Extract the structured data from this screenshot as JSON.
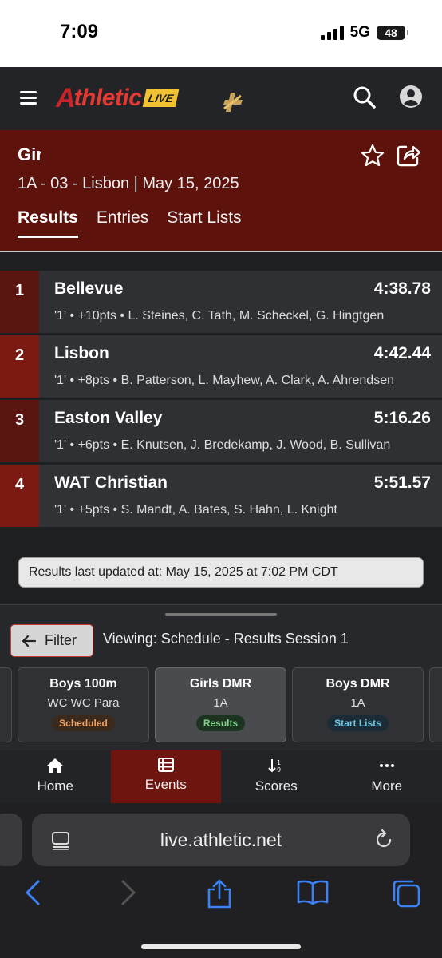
{
  "status_bar": {
    "time": "7:09",
    "network": "5G",
    "battery": "48"
  },
  "app_header": {
    "logo_mark": "A",
    "logo_word": "thletic",
    "logo_badge": "LIVE"
  },
  "event": {
    "title": "Girls DMR",
    "subtitle": "1A - 03 - Lisbon | May 15, 2025",
    "tabs": [
      "Results",
      "Entries",
      "Start Lists"
    ],
    "active_tab": "Results"
  },
  "results": [
    {
      "place": "1",
      "team": "Bellevue",
      "time": "4:38.78",
      "detail": "'1' • +10pts • L. Steines, C. Tath, M. Scheckel, G. Hingtgen"
    },
    {
      "place": "2",
      "team": "Lisbon",
      "time": "4:42.44",
      "detail": "'1' • +8pts • B. Patterson, L. Mayhew, A. Clark, A. Ahrendsen"
    },
    {
      "place": "3",
      "team": "Easton Valley",
      "time": "5:16.26",
      "detail": "'1' • +6pts • E. Knutsen, J. Bredekamp, J. Wood, B. Sullivan"
    },
    {
      "place": "4",
      "team": "WAT Christian",
      "time": "5:51.57",
      "detail": "'1' • +5pts • S. Mandt, A. Bates, S. Hahn, L. Knight"
    }
  ],
  "updated_text": "Results last updated at: May 15, 2025 at 7:02 PM CDT",
  "sheet": {
    "filter_label": "Filter",
    "viewing_text": "Viewing: Schedule - Results Session 1",
    "cards": [
      {
        "title": "Boys 100m",
        "sub": "WC WC Para",
        "badge": "Scheduled",
        "badge_color": "#f0a060",
        "badge_bg": "#3b2a1c"
      },
      {
        "title": "Girls DMR",
        "sub": "1A",
        "badge": "Results",
        "badge_color": "#7fd08a",
        "badge_bg": "#1c3320"
      },
      {
        "title": "Boys DMR",
        "sub": "1A",
        "badge": "Start Lists",
        "badge_color": "#6cc8e8",
        "badge_bg": "#1b2c36"
      }
    ]
  },
  "bottom_nav": [
    {
      "label": "Home",
      "icon": "home-icon"
    },
    {
      "label": "Events",
      "icon": "list-icon"
    },
    {
      "label": "Scores",
      "icon": "sort-icon"
    },
    {
      "label": "More",
      "icon": "more-icon"
    }
  ],
  "safari": {
    "url": "live.athletic.net"
  },
  "colors": {
    "accent": "#5e120c",
    "active_nav": "#6e150f",
    "ios_blue": "#3b82f6"
  }
}
